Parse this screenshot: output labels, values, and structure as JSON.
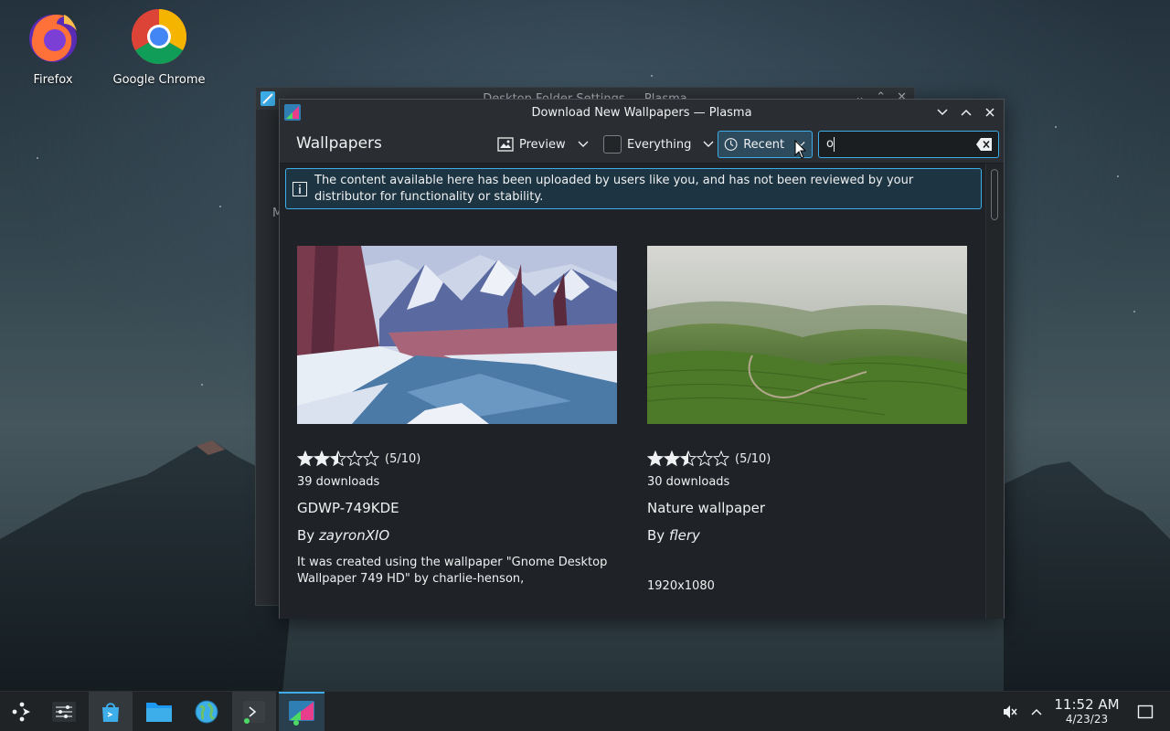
{
  "desktop": {
    "icons": [
      {
        "label": "Firefox"
      },
      {
        "label": "Google Chrome"
      }
    ]
  },
  "background_window": {
    "title": "Desktop Folder Settings — Plasma",
    "partial_text": "M"
  },
  "window": {
    "title": "Download New Wallpapers — Plasma",
    "heading": "Wallpapers",
    "toolbar": {
      "view_label": "Preview",
      "filter_label": "Everything",
      "sort_label": "Recent",
      "search_value": "o"
    },
    "notice": "The content available here has been uploaded by users like you, and has not been reviewed by your distributor for functionality or stability.",
    "items": [
      {
        "rating": 5,
        "rating_text": "(5/10)",
        "downloads": "39 downloads",
        "name": "GDWP-749KDE",
        "by_prefix": "By ",
        "author": "zayronXIO",
        "description": "It was created using the wallpaper \"Gnome Desktop Wallpaper 749 HD\" by charlie-henson,"
      },
      {
        "rating": 5,
        "rating_text": "(5/10)",
        "downloads": "30 downloads",
        "name": "Nature wallpaper",
        "by_prefix": "By ",
        "author": "flery",
        "description": "1920x1080"
      }
    ]
  },
  "taskbar": {
    "clock_time": "11:52 AM",
    "clock_date": "4/23/23"
  },
  "colors": {
    "accent": "#3daee9",
    "window_bg": "#1f2226",
    "titlebar_bg": "#2a2e32"
  }
}
